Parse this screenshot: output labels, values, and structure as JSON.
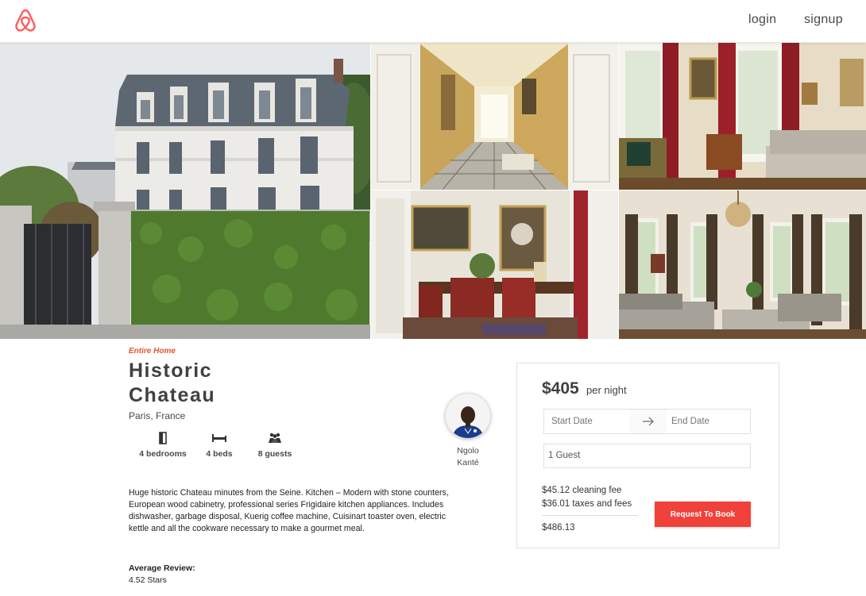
{
  "header": {
    "logo_icon": "airbnb-belo-icon",
    "login_label": "login",
    "signup_label": "signup"
  },
  "colors": {
    "brand": "#ff5a5f",
    "accent_label": "#e4572e",
    "book_button": "#f0413a"
  },
  "gallery": {
    "photos": [
      "chateau-exterior-photo",
      "hallway-photo",
      "salon-photo",
      "dining-room-photo",
      "living-room-photo"
    ]
  },
  "listing": {
    "type_label": "Entire Home",
    "title_line1": "Historic",
    "title_line2": "Chateau",
    "location": "Paris, France",
    "amenities": {
      "bedrooms": "4 bedrooms",
      "beds": "4 beds",
      "guests": "8 guests"
    },
    "description": "Huge historic Chateau minutes from the Seine. Kitchen – Modern with stone counters, European wood cabinetry, professional series Frigidaire kitchen appliances. Includes dishwasher, garbage disposal, Kuerig coffee machine, Cuisinart toaster oven, electric kettle and all the cookware necessary to make a gourmet meal.",
    "review_label": "Average Review:",
    "review_value": "4.52 Stars"
  },
  "host": {
    "name_line1": "Ngolo",
    "name_line2": "Kanté"
  },
  "booking": {
    "price": "$405",
    "per_night": "per night",
    "start_date_placeholder": "Start Date",
    "end_date_placeholder": "End Date",
    "guests_value": "1 Guest",
    "cleaning_fee": "$45.12 cleaning fee",
    "taxes_fees": "$36.01 taxes and fees",
    "total": "$486.13",
    "book_label": "Request To Book"
  }
}
